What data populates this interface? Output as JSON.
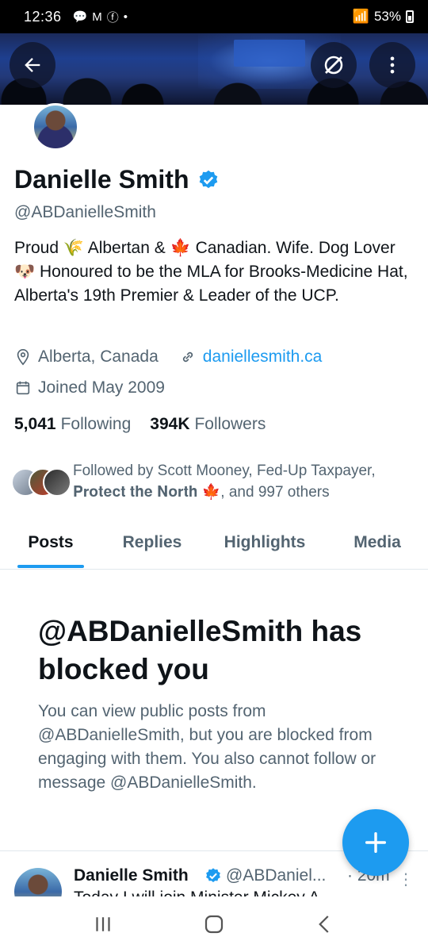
{
  "status_bar": {
    "time": "12:36",
    "battery": "53%"
  },
  "profile": {
    "name": "Danielle Smith",
    "handle": "@ABDanielleSmith",
    "bio": "Proud 🌾 Albertan & 🍁 Canadian. Wife. Dog Lover 🐶 Honoured to be the MLA for Brooks-Medicine Hat, Alberta's 19th Premier & Leader of the UCP.",
    "location": "Alberta, Canada",
    "website": "daniellesmith.ca",
    "joined": "Joined May 2009",
    "following_count": "5,041",
    "following_label": "Following",
    "followers_count": "394K",
    "followers_label": "Followers",
    "followed_by": "Followed by Scott Mooney, Fed-Up Taxpayer, 𝐏𝐫𝐨𝐭𝐞𝐜𝐭 𝐭𝐡𝐞 𝐍𝐨𝐫𝐭𝐡 🍁, and 997 others"
  },
  "tabs": [
    "Posts",
    "Replies",
    "Highlights",
    "Media"
  ],
  "blocked": {
    "title": "@ABDanielleSmith has blocked you",
    "body": "You can view public posts from @ABDanielleSmith, but you are blocked from engaging with them. You also cannot follow or message @ABDanielleSmith."
  },
  "post": {
    "name": "Danielle Smith",
    "handle": "@ABDaniel...",
    "time": "· 20m",
    "snippet": "Today I will join Minister Mickey A"
  },
  "colors": {
    "accent": "#1d9bf0",
    "text": "#0f1419",
    "muted": "#536471"
  },
  "icons": [
    "back-arrow-icon",
    "grok-icon",
    "more-vertical-icon",
    "verified-icon",
    "location-pin-icon",
    "link-icon",
    "calendar-icon",
    "compose-plus-icon"
  ]
}
